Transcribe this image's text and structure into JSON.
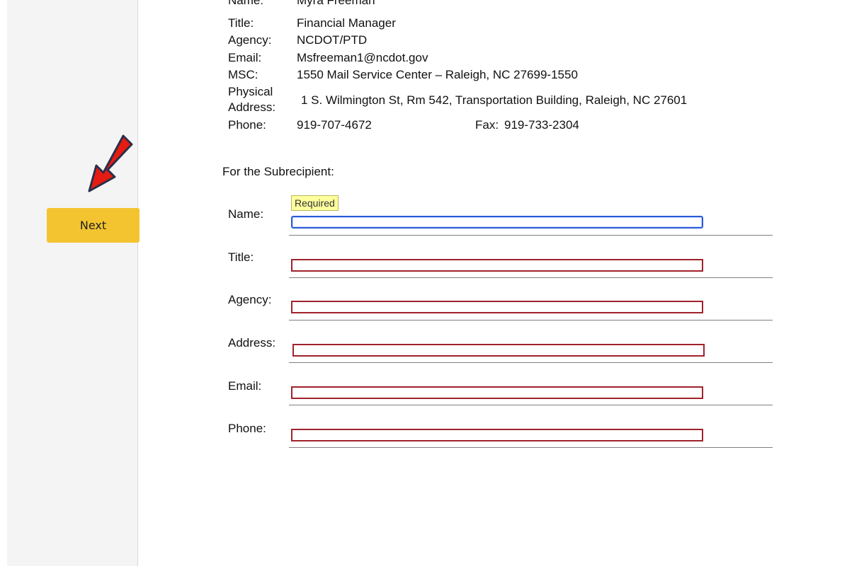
{
  "sidebar": {
    "next_label": "Next"
  },
  "contact": {
    "name_label": "Name:",
    "name_value": "Myra Freeman",
    "title_label": "Title:",
    "title_value": "Financial Manager",
    "agency_label": "Agency:",
    "agency_value": "NCDOT/PTD",
    "email_label": "Email:",
    "email_value": "Msfreeman1@ncdot.gov",
    "msc_label": "MSC:",
    "msc_value": "1550 Mail Service Center – Raleigh, NC 27699-1550",
    "physical_label_1": "Physical",
    "physical_label_2": "Address:",
    "physical_value": "1 S. Wilmington St, Rm 542, Transportation Building, Raleigh, NC 27601",
    "phone_label": "Phone:",
    "phone_value": "919-707-4672",
    "fax_label": "Fax:",
    "fax_value": "919-733-2304"
  },
  "subrecipient": {
    "heading": "For the Subrecipient:",
    "tooltip": "Required",
    "fields": [
      {
        "label": "Name:",
        "value": ""
      },
      {
        "label": "Title:",
        "value": ""
      },
      {
        "label": "Agency:",
        "value": ""
      },
      {
        "label": "Address:",
        "value": ""
      },
      {
        "label": "Email:",
        "value": ""
      },
      {
        "label": "Phone:",
        "value": ""
      }
    ]
  },
  "colors": {
    "button": "#f4c430",
    "arrow": "#e01010",
    "field_border": "#a0222c",
    "focus_border": "#2a5bd7"
  },
  "icons": {
    "arrow": "red-down-arrow-icon"
  }
}
